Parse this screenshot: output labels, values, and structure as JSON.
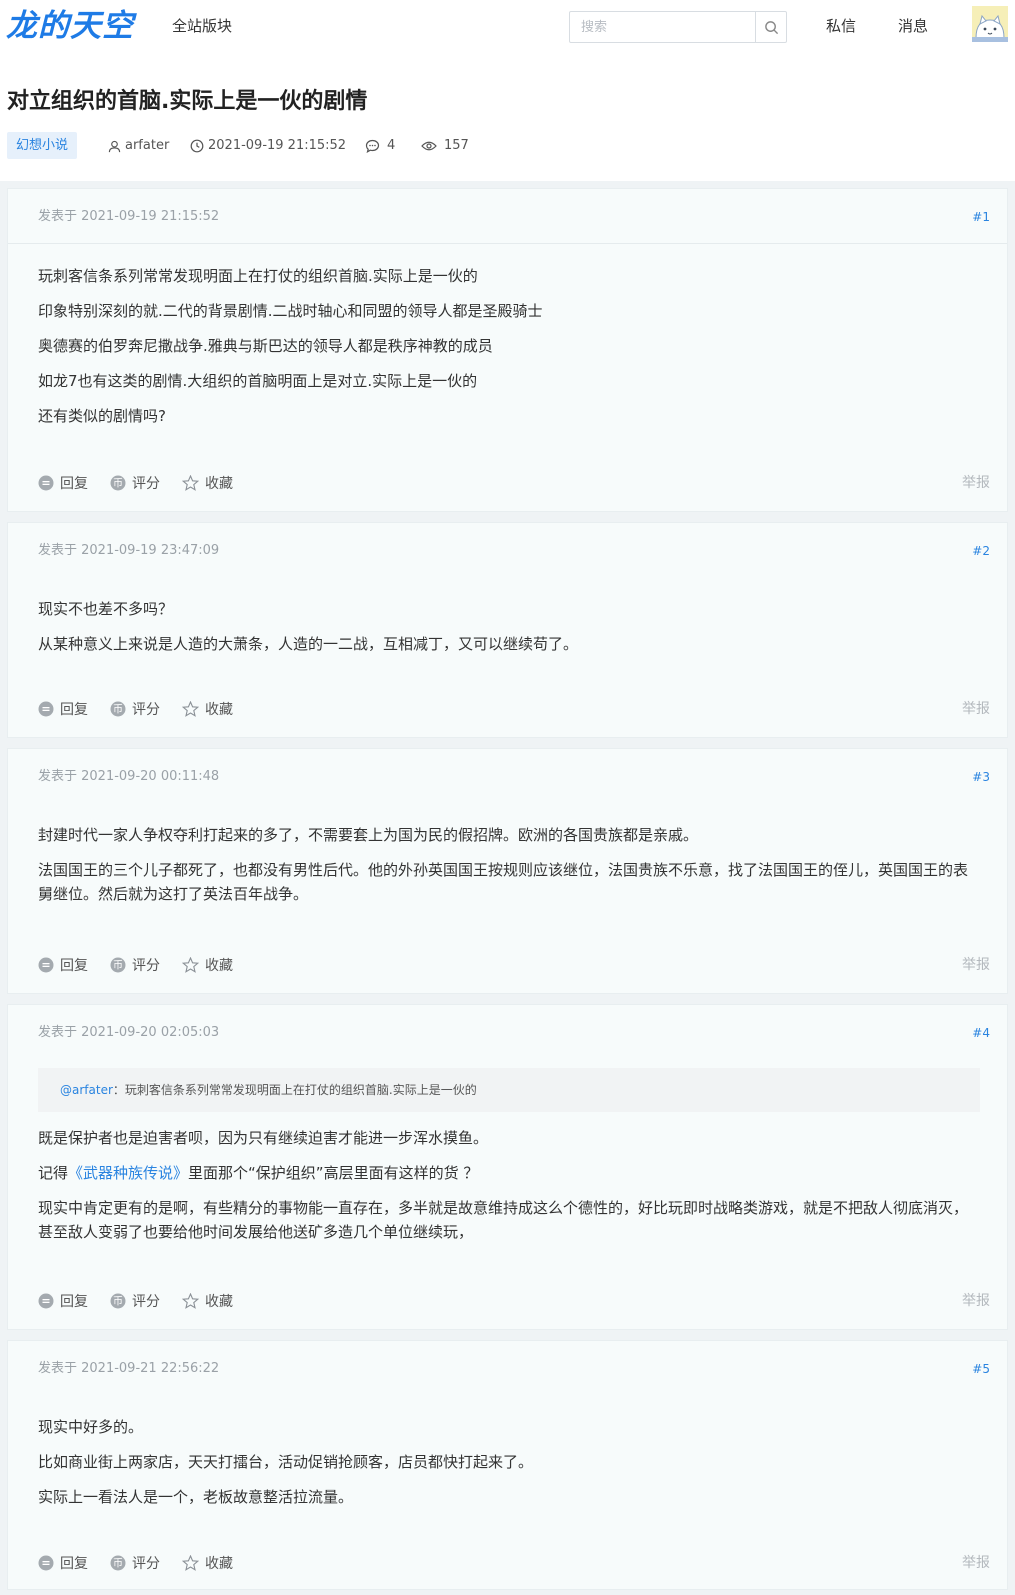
{
  "topbar": {
    "logo": "龙的天空",
    "nav_all": "全站版块",
    "search_placeholder": "搜索",
    "messages": "私信",
    "notifications": "消息"
  },
  "thread": {
    "title": "对立组织的首脑.实际上是一伙的剧情",
    "category": "幻想小说",
    "author": "arfater",
    "datetime": "2021-09-19 21:15:52",
    "replies": "4",
    "views": "157"
  },
  "labels": {
    "reply": "回复",
    "rate": "评分",
    "favorite": "收藏",
    "report": "举报"
  },
  "posts": [
    {
      "head": "发表于 2021-09-19 21:15:52",
      "floor": "#1",
      "lines": [
        "玩刺客信条系列常常发现明面上在打仗的组织首脑.实际上是一伙的",
        "印象特别深刻的就.二代的背景剧情.二战时轴心和同盟的领导人都是圣殿骑士",
        "奥德赛的伯罗奔尼撒战争.雅典与斯巴达的领导人都是秩序神教的成员",
        "如龙7也有这类的剧情.大组织的首脑明面上是对立.实际上是一伙的",
        "还有类似的剧情吗?"
      ]
    },
    {
      "head": "发表于 2021-09-19 23:47:09",
      "floor": "#2",
      "lines": [
        "现实不也差不多吗？",
        "从某种意义上来说是人造的大萧条，人造的一二战，互相减丁，又可以继续苟了。"
      ]
    },
    {
      "head": "发表于 2021-09-20 00:11:48",
      "floor": "#3",
      "lines": [
        "封建时代一家人争权夺利打起来的多了，不需要套上为国为民的假招牌。欧洲的各国贵族都是亲戚。",
        "法国国王的三个儿子都死了，也都没有男性后代。他的外孙英国国王按规则应该继位，法国贵族不乐意，找了法国国王的侄儿，英国国王的表舅继位。然后就为这打了英法百年战争。"
      ]
    },
    {
      "head": "发表于 2021-09-20 02:05:03",
      "floor": "#4",
      "quote_user": "@arfater",
      "quote_text": "：玩刺客信条系列常常发现明面上在打仗的组织首脑.实际上是一伙的",
      "line1": "既是保护者也是迫害者呗，因为只有继续迫害才能进一步浑水摸鱼。",
      "line2_pre": "记得",
      "line2_link": "《武器种族传说》",
      "line2_post": "里面那个“保护组织”高层里面有这样的货 ？",
      "line3": "现实中肯定更有的是啊，有些精分的事物能一直存在，多半就是故意维持成这么个德性的，好比玩即时战略类游戏，就是不把敌人彻底消灭，甚至敌人变弱了也要给他时间发展给他送矿多造几个单位继续玩，"
    },
    {
      "head": "发表于 2021-09-21 22:56:22",
      "floor": "#5",
      "lines": [
        "现实中好多的。",
        "比如商业街上两家店，天天打擂台，活动促销抢顾客，店员都快打起来了。",
        "实际上一看法人是一个，老板故意整活拉流量。"
      ]
    }
  ]
}
